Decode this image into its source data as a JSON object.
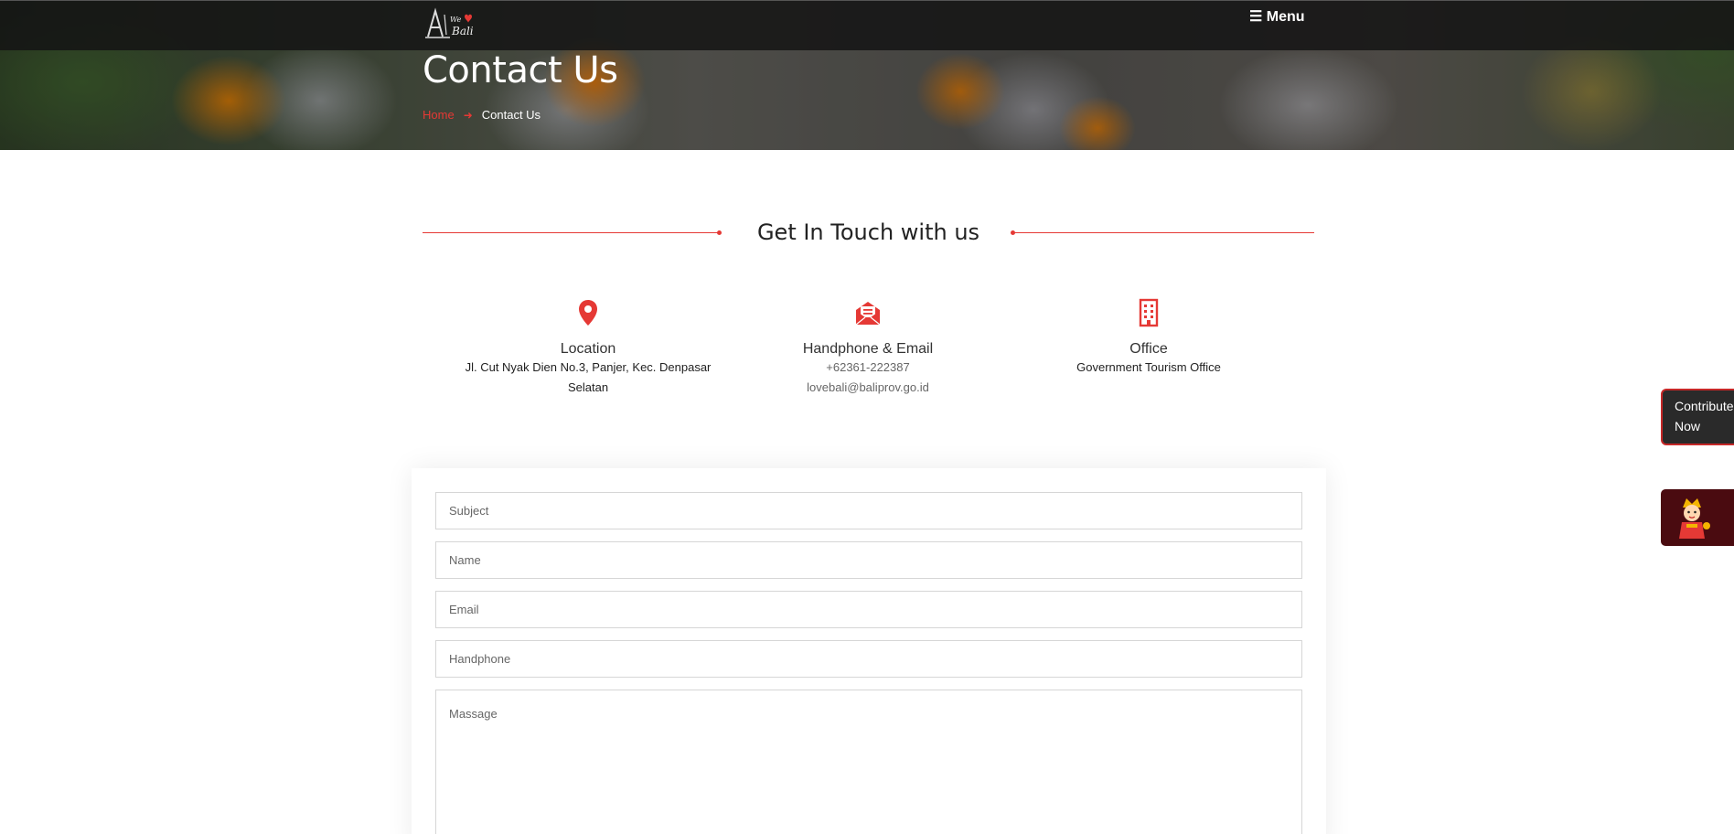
{
  "header": {
    "logo_alt": "We Love Bali",
    "menu_label": "☰ Menu"
  },
  "hero": {
    "title": "Contact Us",
    "breadcrumb": {
      "home": "Home",
      "separator": "➜",
      "current": "Contact Us"
    }
  },
  "section": {
    "heading": "Get In Touch with us"
  },
  "info": {
    "location": {
      "icon": "map-pin-icon",
      "title": "Location",
      "address": "Jl. Cut Nyak Dien No.3, Panjer, Kec. Denpasar Selatan"
    },
    "contact": {
      "icon": "envelope-icon",
      "title": "Handphone & Email",
      "phone": "+62361-222387",
      "email": "lovebali@baliprov.go.id"
    },
    "office": {
      "icon": "building-icon",
      "title": "Office",
      "name": "Government Tourism Office"
    }
  },
  "form": {
    "subject_placeholder": "Subject",
    "name_placeholder": "Name",
    "email_placeholder": "Email",
    "phone_placeholder": "Handphone",
    "message_placeholder": "Massage"
  },
  "widgets": {
    "contribute_label": "Contribute Now",
    "mascot_icon": "balinese-mascot-icon"
  },
  "colors": {
    "accent": "#e53935",
    "topbar": "#141414",
    "widget_dark": "#4a0b10"
  }
}
